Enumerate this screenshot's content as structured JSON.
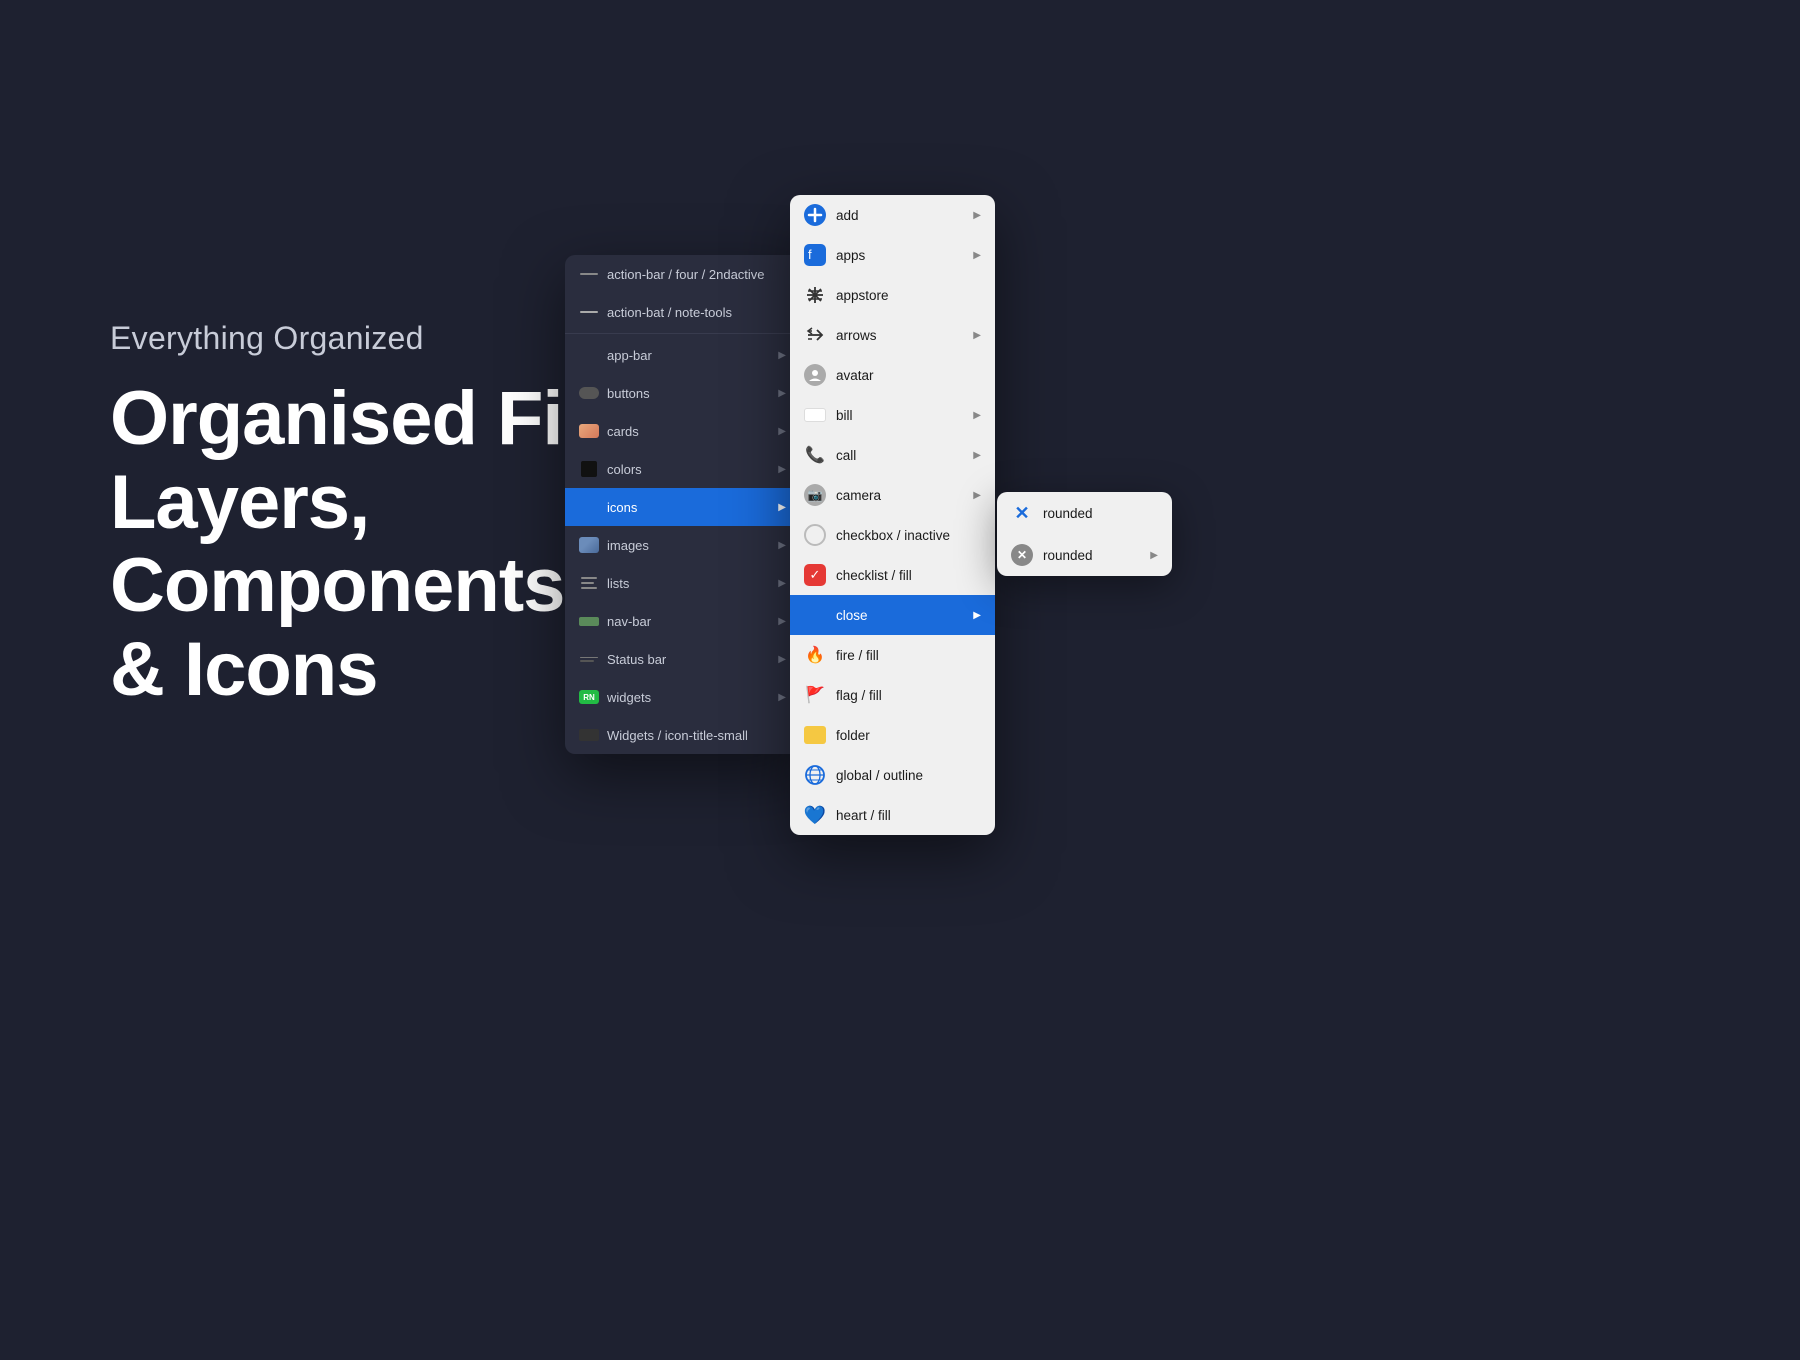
{
  "background": "#1e2130",
  "hero": {
    "subtitle": "Everything Organized",
    "title_line1": "Organised Files,",
    "title_line2": "Layers,",
    "title_line3": "Components",
    "title_line4": "& Icons"
  },
  "layers_panel": {
    "items": [
      {
        "id": "action-bar-four",
        "label": "action-bar / four / 2ndactive",
        "icon_type": "dash",
        "has_chevron": false
      },
      {
        "id": "action-bat-note",
        "label": "action-bat / note-tools",
        "icon_type": "dash",
        "has_chevron": false
      },
      {
        "id": "app-bar",
        "label": "app-bar",
        "icon_type": "none",
        "has_chevron": true
      },
      {
        "id": "buttons",
        "label": "buttons",
        "icon_type": "btn",
        "has_chevron": true
      },
      {
        "id": "cards",
        "label": "cards",
        "icon_type": "cards",
        "has_chevron": true
      },
      {
        "id": "colors",
        "label": "colors",
        "icon_type": "black-sq",
        "has_chevron": true
      },
      {
        "id": "icons",
        "label": "icons",
        "icon_type": "none",
        "has_chevron": true,
        "active": true
      },
      {
        "id": "images",
        "label": "images",
        "icon_type": "photo",
        "has_chevron": true
      },
      {
        "id": "lists",
        "label": "lists",
        "icon_type": "lists",
        "has_chevron": true
      },
      {
        "id": "nav-bar",
        "label": "nav-bar",
        "icon_type": "nav",
        "has_chevron": true
      },
      {
        "id": "status-bar",
        "label": "Status bar",
        "icon_type": "status",
        "has_chevron": true
      },
      {
        "id": "widgets",
        "label": "widgets",
        "icon_type": "widgets",
        "has_chevron": true
      },
      {
        "id": "widgets-icon",
        "label": "Widgets / icon-title-small",
        "icon_type": "widget-sm",
        "has_chevron": false
      }
    ]
  },
  "icons_panel": {
    "items": [
      {
        "id": "add",
        "label": "add",
        "icon_type": "plus-blue",
        "has_chevron": true
      },
      {
        "id": "apps",
        "label": "apps",
        "icon_type": "apps-blue",
        "has_chevron": true
      },
      {
        "id": "appstore",
        "label": "appstore",
        "icon_type": "appstore",
        "has_chevron": false
      },
      {
        "id": "arrows",
        "label": "arrows",
        "icon_type": "arrows",
        "has_chevron": true
      },
      {
        "id": "avatar",
        "label": "avatar",
        "icon_type": "avatar",
        "has_chevron": false
      },
      {
        "id": "bill",
        "label": "bill",
        "icon_type": "bill",
        "has_chevron": true
      },
      {
        "id": "call",
        "label": "call",
        "icon_type": "call",
        "has_chevron": true
      },
      {
        "id": "camera",
        "label": "camera",
        "icon_type": "camera",
        "has_chevron": true
      },
      {
        "id": "checkbox",
        "label": "checkbox / inactive",
        "icon_type": "checkbox",
        "has_chevron": false
      },
      {
        "id": "checklist",
        "label": "checklist / fill",
        "icon_type": "checklist",
        "has_chevron": false
      },
      {
        "id": "close",
        "label": "close",
        "icon_type": "none",
        "has_chevron": true,
        "active": true
      },
      {
        "id": "fire",
        "label": "fire / fill",
        "icon_type": "fire",
        "has_chevron": false
      },
      {
        "id": "flag",
        "label": "flag / fill",
        "icon_type": "flag",
        "has_chevron": false
      },
      {
        "id": "folder",
        "label": "folder",
        "icon_type": "folder",
        "has_chevron": false
      },
      {
        "id": "global",
        "label": "global / outline",
        "icon_type": "globe",
        "has_chevron": false
      },
      {
        "id": "heart",
        "label": "heart / fill",
        "icon_type": "heart",
        "has_chevron": false
      }
    ]
  },
  "submenu": {
    "items": [
      {
        "id": "rounded-1",
        "label": "rounded",
        "icon_type": "cross-blue",
        "has_chevron": false
      },
      {
        "id": "rounded-2",
        "label": "rounded",
        "icon_type": "cross-gray",
        "has_chevron": true
      }
    ]
  }
}
